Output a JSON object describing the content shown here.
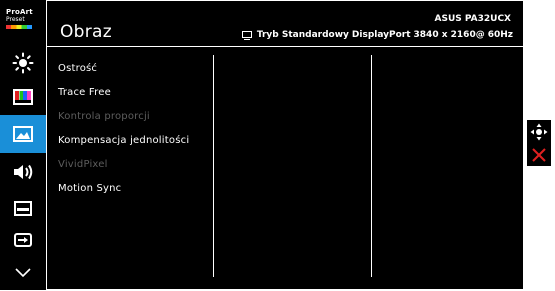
{
  "sidebar": {
    "logo": {
      "line1": "ProArt",
      "line2": "Preset"
    },
    "items": [
      {
        "icon": "brightness-icon"
      },
      {
        "icon": "color-bars-icon"
      },
      {
        "icon": "image-icon",
        "active": true
      },
      {
        "icon": "speaker-icon"
      },
      {
        "icon": "pip-icon"
      },
      {
        "icon": "input-select-icon"
      },
      {
        "icon": "chevron-down-icon"
      }
    ]
  },
  "header": {
    "title": "Obraz",
    "model": "ASUS PA32UCX",
    "mode": "Tryb Standardowy",
    "input": "DisplayPort",
    "resolution": "3840 x 2160@",
    "refresh": "60Hz"
  },
  "menu": {
    "items": [
      {
        "label": "Ostrość",
        "enabled": true
      },
      {
        "label": "Trace Free",
        "enabled": true
      },
      {
        "label": "Kontrola proporcji",
        "enabled": false
      },
      {
        "label": "Kompensacja jednolitości",
        "enabled": true
      },
      {
        "label": "VividPixel",
        "enabled": false
      },
      {
        "label": "Motion Sync",
        "enabled": true
      }
    ]
  },
  "controls": {
    "navigate_icon": "joystick-icon",
    "close_icon": "close-icon"
  },
  "colors": {
    "accent": "#1a8fd8",
    "background": "#000000",
    "text": "#ffffff",
    "disabled": "#5d5d5d",
    "close": "#e02020"
  }
}
